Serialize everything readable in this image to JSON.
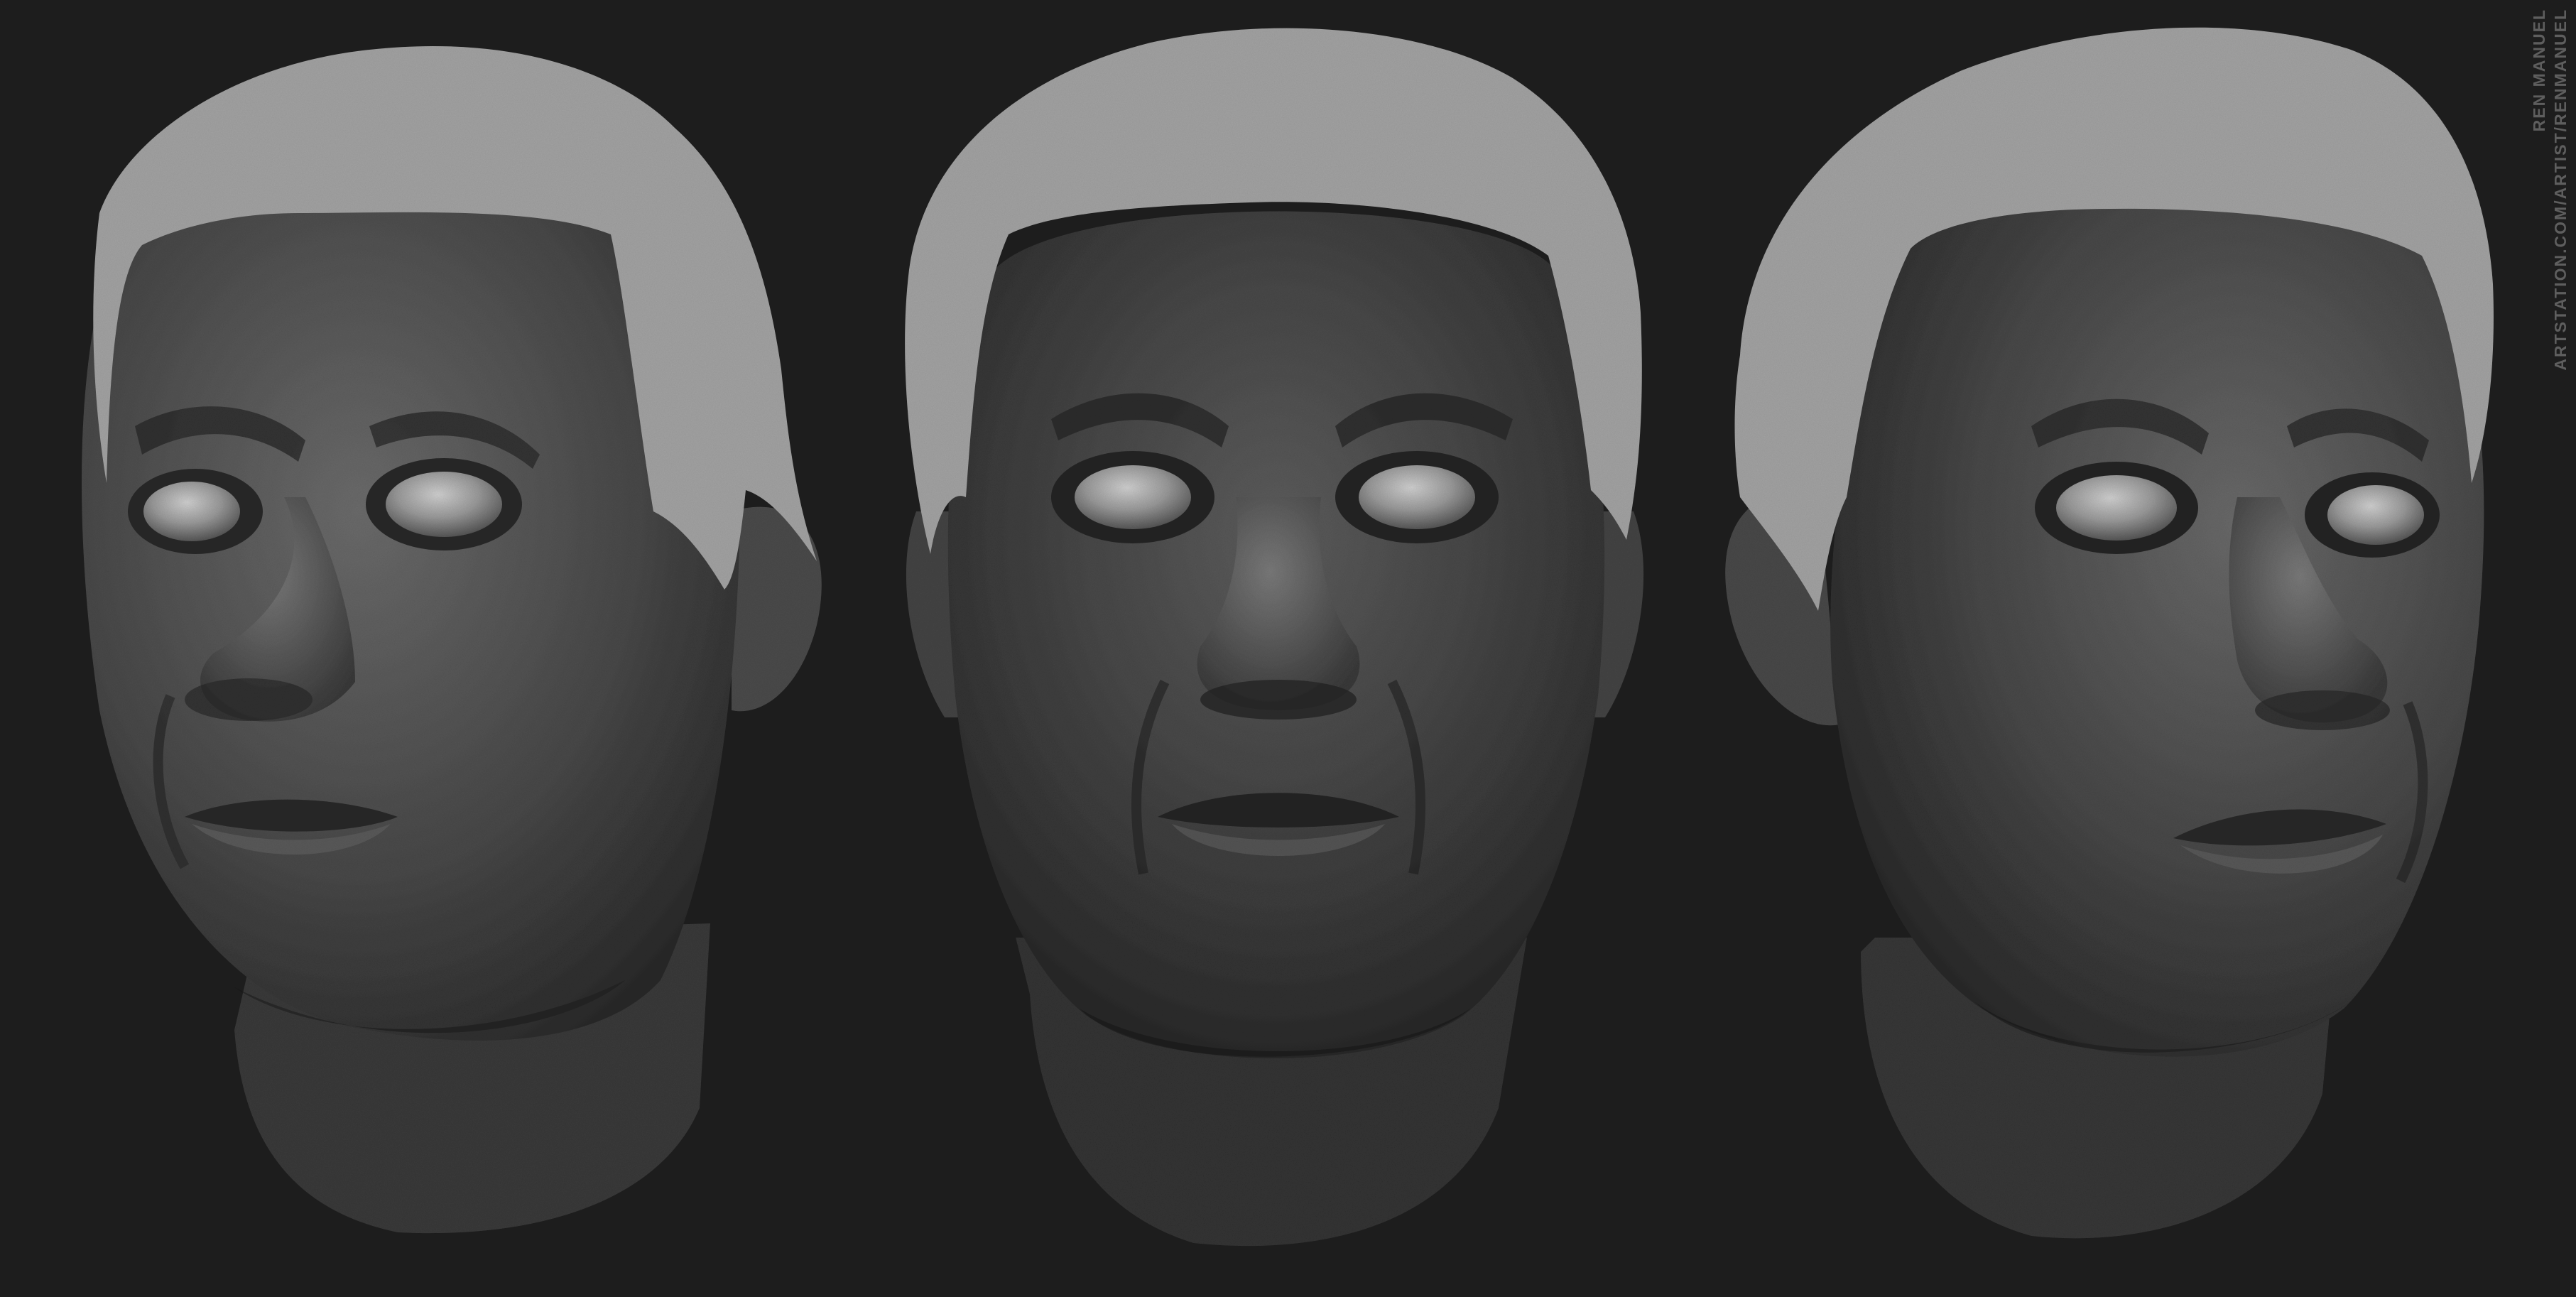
{
  "image": {
    "subject": "three-views-of-sculpted-head",
    "views": [
      {
        "name": "three-quarter-left"
      },
      {
        "name": "front"
      },
      {
        "name": "three-quarter-right"
      }
    ],
    "colors": {
      "background": "#1d1d1d",
      "skin": "#5a5a5a",
      "hair": "#a3a3a3",
      "eyes": "#8a8a8a"
    }
  },
  "watermark": {
    "name": "REN MANUEL",
    "url": "ARTSTATION.COM/ARTIST/RENMANUEL"
  }
}
